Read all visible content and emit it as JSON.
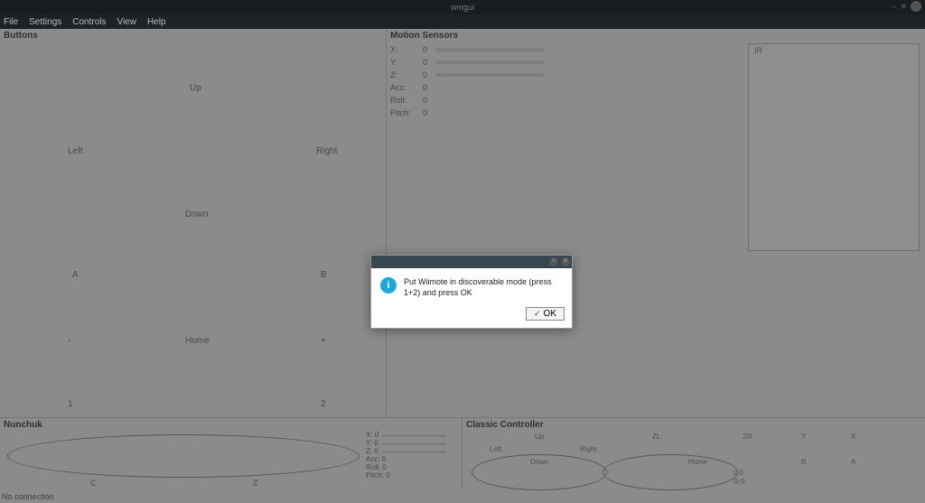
{
  "topbar": {
    "title": "wmgui",
    "minimize": "–",
    "close": "✕"
  },
  "menubar": [
    "File",
    "Settings",
    "Controls",
    "View",
    "Help"
  ],
  "sections": {
    "buttons": "Buttons",
    "motion": "Motion Sensors",
    "nunchuk": "Nunchuk",
    "classic": "Classic Controller",
    "ir": "IR"
  },
  "buttons_grid": {
    "up": "Up",
    "left": "Left",
    "right": "Right",
    "down": "Down",
    "a": "A",
    "b": "B",
    "minus": "-",
    "home": "Home",
    "plus": "+",
    "one": "1",
    "two": "2"
  },
  "motion": {
    "rows": [
      {
        "name": "X:",
        "val": "0"
      },
      {
        "name": "Y:",
        "val": "0"
      },
      {
        "name": "Z:",
        "val": "0"
      },
      {
        "name": "Acc:",
        "val": "0"
      },
      {
        "name": "Roll:",
        "val": "0"
      },
      {
        "name": "Pitch:",
        "val": "0"
      }
    ]
  },
  "nunchuk": {
    "rows": [
      {
        "name": "X:",
        "val": "0"
      },
      {
        "name": "Y:",
        "val": "0"
      },
      {
        "name": "Z:",
        "val": "0"
      },
      {
        "name": "Acc:",
        "val": "0"
      },
      {
        "name": "Roll:",
        "val": "0"
      },
      {
        "name": "Pitch:",
        "val": "0"
      }
    ],
    "c": "C",
    "z": "Z"
  },
  "classic": {
    "up": "Up",
    "left": "Left",
    "right": "Right",
    "down": "Down",
    "zl": "ZL",
    "zr": "ZR",
    "home": "Home",
    "y": "Y",
    "x": "X",
    "a": "A",
    "b": "B",
    "l0": "L:0",
    "r0": "R:0"
  },
  "status": "No connection",
  "dialog": {
    "message": "Put Wiimote in discoverable mode (press 1+2) and press OK",
    "ok": "OK",
    "down_glyph": "˅",
    "close_glyph": "✕",
    "info_glyph": "i",
    "check_glyph": "✓"
  }
}
